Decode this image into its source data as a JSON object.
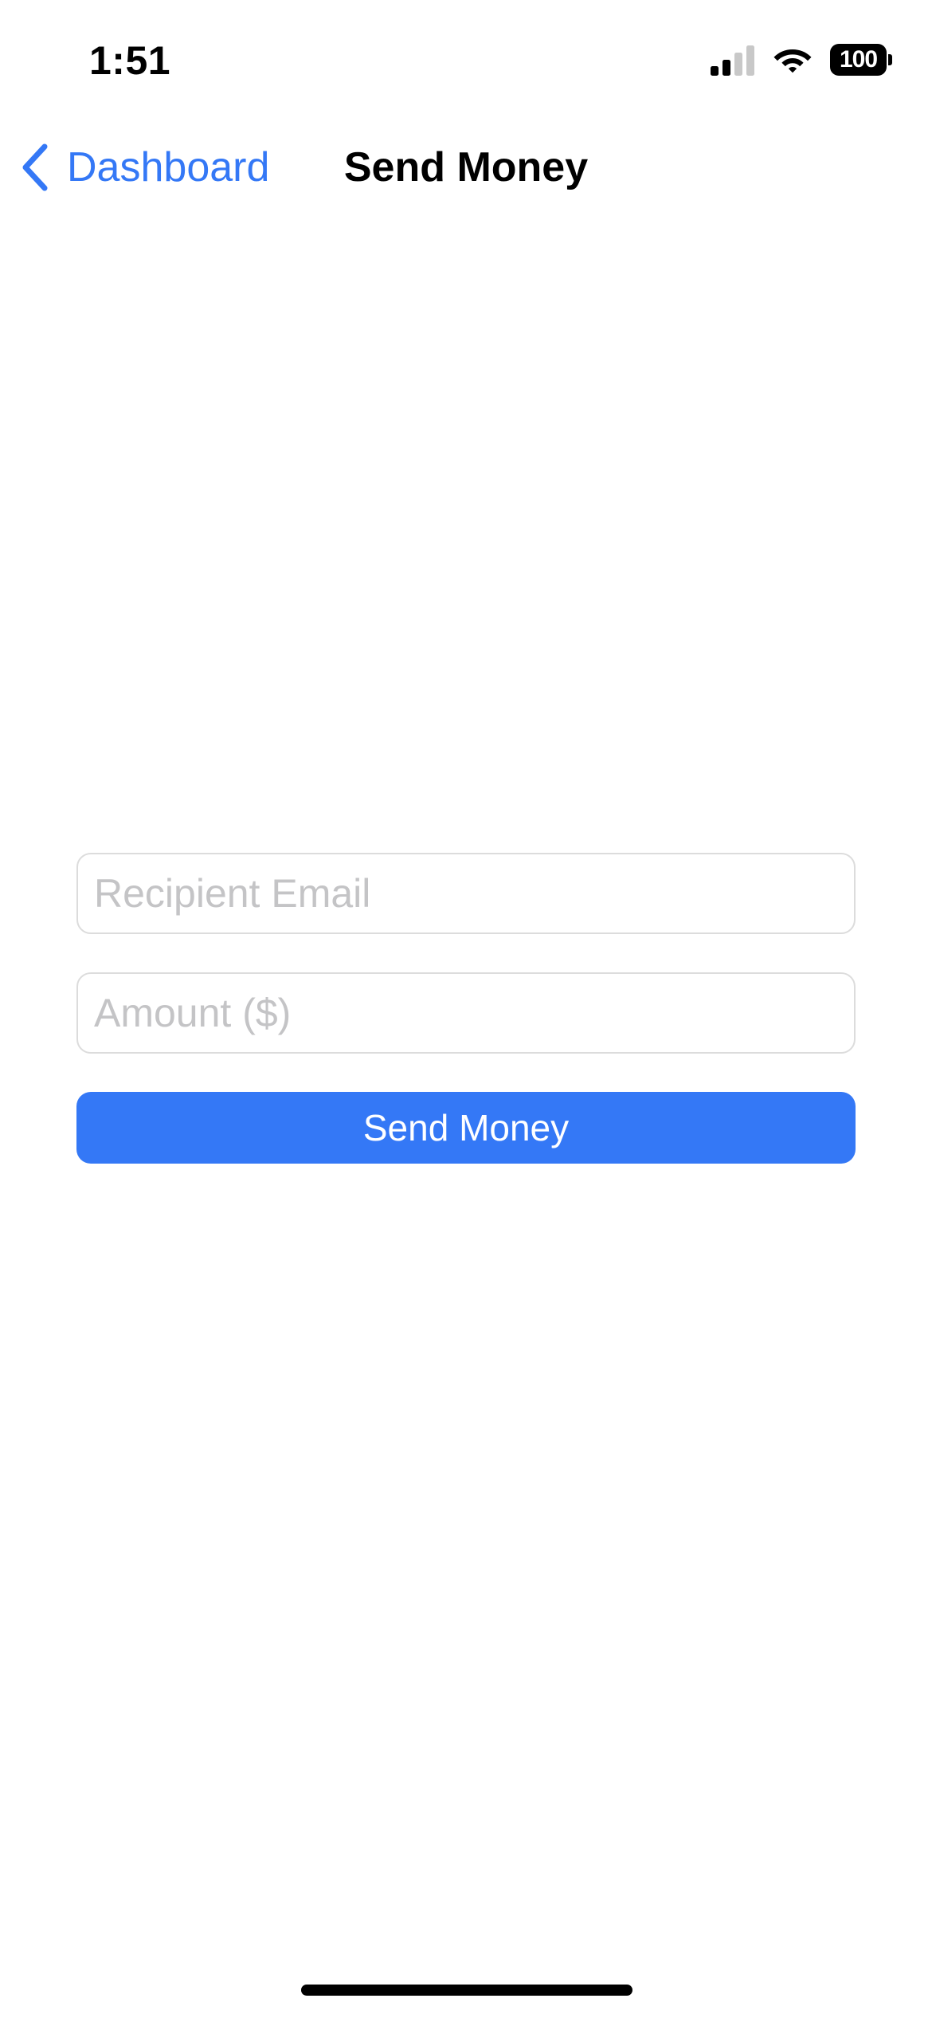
{
  "status_bar": {
    "time": "1:51",
    "battery_level": "100",
    "signal_icon": "cellular-signal-icon",
    "wifi_icon": "wifi-icon"
  },
  "nav": {
    "back_label": "Dashboard",
    "back_icon": "chevron-left-icon",
    "title": "Send Money"
  },
  "form": {
    "recipient_email": {
      "value": "",
      "placeholder": "Recipient Email"
    },
    "amount": {
      "value": "",
      "placeholder": "Amount ($)"
    },
    "submit_label": "Send Money"
  },
  "colors": {
    "accent": "#3478f6",
    "placeholder": "#c4c4c6",
    "field_border": "#dcdcdc",
    "background": "#ffffff"
  }
}
